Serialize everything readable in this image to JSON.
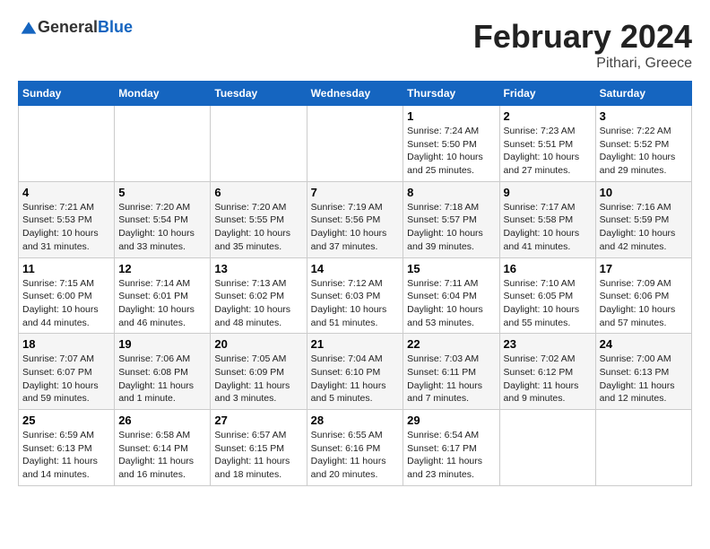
{
  "header": {
    "logo_general": "General",
    "logo_blue": "Blue",
    "title": "February 2024",
    "subtitle": "Pithari, Greece"
  },
  "columns": [
    "Sunday",
    "Monday",
    "Tuesday",
    "Wednesday",
    "Thursday",
    "Friday",
    "Saturday"
  ],
  "weeks": [
    [
      {
        "day": "",
        "info": ""
      },
      {
        "day": "",
        "info": ""
      },
      {
        "day": "",
        "info": ""
      },
      {
        "day": "",
        "info": ""
      },
      {
        "day": "1",
        "info": "Sunrise: 7:24 AM\nSunset: 5:50 PM\nDaylight: 10 hours and 25 minutes."
      },
      {
        "day": "2",
        "info": "Sunrise: 7:23 AM\nSunset: 5:51 PM\nDaylight: 10 hours and 27 minutes."
      },
      {
        "day": "3",
        "info": "Sunrise: 7:22 AM\nSunset: 5:52 PM\nDaylight: 10 hours and 29 minutes."
      }
    ],
    [
      {
        "day": "4",
        "info": "Sunrise: 7:21 AM\nSunset: 5:53 PM\nDaylight: 10 hours and 31 minutes."
      },
      {
        "day": "5",
        "info": "Sunrise: 7:20 AM\nSunset: 5:54 PM\nDaylight: 10 hours and 33 minutes."
      },
      {
        "day": "6",
        "info": "Sunrise: 7:20 AM\nSunset: 5:55 PM\nDaylight: 10 hours and 35 minutes."
      },
      {
        "day": "7",
        "info": "Sunrise: 7:19 AM\nSunset: 5:56 PM\nDaylight: 10 hours and 37 minutes."
      },
      {
        "day": "8",
        "info": "Sunrise: 7:18 AM\nSunset: 5:57 PM\nDaylight: 10 hours and 39 minutes."
      },
      {
        "day": "9",
        "info": "Sunrise: 7:17 AM\nSunset: 5:58 PM\nDaylight: 10 hours and 41 minutes."
      },
      {
        "day": "10",
        "info": "Sunrise: 7:16 AM\nSunset: 5:59 PM\nDaylight: 10 hours and 42 minutes."
      }
    ],
    [
      {
        "day": "11",
        "info": "Sunrise: 7:15 AM\nSunset: 6:00 PM\nDaylight: 10 hours and 44 minutes."
      },
      {
        "day": "12",
        "info": "Sunrise: 7:14 AM\nSunset: 6:01 PM\nDaylight: 10 hours and 46 minutes."
      },
      {
        "day": "13",
        "info": "Sunrise: 7:13 AM\nSunset: 6:02 PM\nDaylight: 10 hours and 48 minutes."
      },
      {
        "day": "14",
        "info": "Sunrise: 7:12 AM\nSunset: 6:03 PM\nDaylight: 10 hours and 51 minutes."
      },
      {
        "day": "15",
        "info": "Sunrise: 7:11 AM\nSunset: 6:04 PM\nDaylight: 10 hours and 53 minutes."
      },
      {
        "day": "16",
        "info": "Sunrise: 7:10 AM\nSunset: 6:05 PM\nDaylight: 10 hours and 55 minutes."
      },
      {
        "day": "17",
        "info": "Sunrise: 7:09 AM\nSunset: 6:06 PM\nDaylight: 10 hours and 57 minutes."
      }
    ],
    [
      {
        "day": "18",
        "info": "Sunrise: 7:07 AM\nSunset: 6:07 PM\nDaylight: 10 hours and 59 minutes."
      },
      {
        "day": "19",
        "info": "Sunrise: 7:06 AM\nSunset: 6:08 PM\nDaylight: 11 hours and 1 minute."
      },
      {
        "day": "20",
        "info": "Sunrise: 7:05 AM\nSunset: 6:09 PM\nDaylight: 11 hours and 3 minutes."
      },
      {
        "day": "21",
        "info": "Sunrise: 7:04 AM\nSunset: 6:10 PM\nDaylight: 11 hours and 5 minutes."
      },
      {
        "day": "22",
        "info": "Sunrise: 7:03 AM\nSunset: 6:11 PM\nDaylight: 11 hours and 7 minutes."
      },
      {
        "day": "23",
        "info": "Sunrise: 7:02 AM\nSunset: 6:12 PM\nDaylight: 11 hours and 9 minutes."
      },
      {
        "day": "24",
        "info": "Sunrise: 7:00 AM\nSunset: 6:13 PM\nDaylight: 11 hours and 12 minutes."
      }
    ],
    [
      {
        "day": "25",
        "info": "Sunrise: 6:59 AM\nSunset: 6:13 PM\nDaylight: 11 hours and 14 minutes."
      },
      {
        "day": "26",
        "info": "Sunrise: 6:58 AM\nSunset: 6:14 PM\nDaylight: 11 hours and 16 minutes."
      },
      {
        "day": "27",
        "info": "Sunrise: 6:57 AM\nSunset: 6:15 PM\nDaylight: 11 hours and 18 minutes."
      },
      {
        "day": "28",
        "info": "Sunrise: 6:55 AM\nSunset: 6:16 PM\nDaylight: 11 hours and 20 minutes."
      },
      {
        "day": "29",
        "info": "Sunrise: 6:54 AM\nSunset: 6:17 PM\nDaylight: 11 hours and 23 minutes."
      },
      {
        "day": "",
        "info": ""
      },
      {
        "day": "",
        "info": ""
      }
    ]
  ]
}
